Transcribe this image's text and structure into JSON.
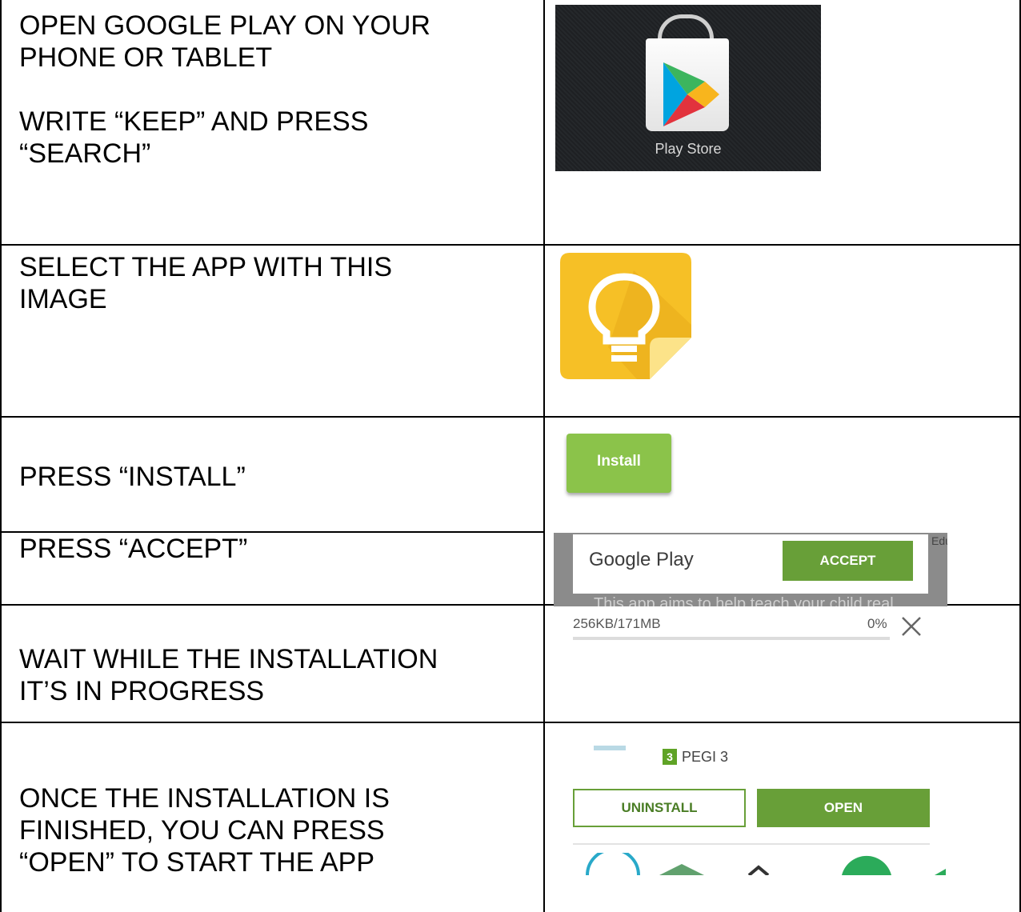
{
  "rows": [
    {
      "instruction": "OPEN GOOGLE PLAY ON YOUR\nPHONE OR TABLET\n\nWRITE “KEEP” AND PRESS\n“SEARCH”"
    },
    {
      "instruction": "SELECT THE APP WITH THIS\nIMAGE"
    },
    {
      "instruction": "PRESS “INSTALL”"
    },
    {
      "instruction": "PRESS “ACCEPT”"
    },
    {
      "instruction": "WAIT WHILE THE INSTALLATION\nIT’S IN PROGRESS"
    },
    {
      "instruction": "ONCE THE INSTALLATION IS\nFINISHED, YOU CAN PRESS\n“OPEN” TO START THE APP"
    }
  ],
  "play_store": {
    "label": "Play Store",
    "icon": "play-store-bag-icon"
  },
  "keep": {
    "icon": "lightbulb-note-icon",
    "colors": {
      "bg": "#F6C026",
      "bulb": "#FFFFFF",
      "corner": "#FCE389"
    }
  },
  "install": {
    "label": "Install",
    "color": "#8BC34A"
  },
  "accept_dialog": {
    "title": "Google Play",
    "button": "ACCEPT",
    "underlay_text": "This app aims to help teach your child real",
    "edge_text": "Edu",
    "button_color": "#689F38"
  },
  "download": {
    "size_text": "256KB/171MB",
    "percent_text": "0%",
    "progress": 0.0,
    "cancel_icon": "close-icon"
  },
  "app_page": {
    "rating_badge": "3",
    "rating_label": "PEGI 3",
    "uninstall_label": "UNINSTALL",
    "open_label": "OPEN",
    "accent": "#689F38"
  }
}
